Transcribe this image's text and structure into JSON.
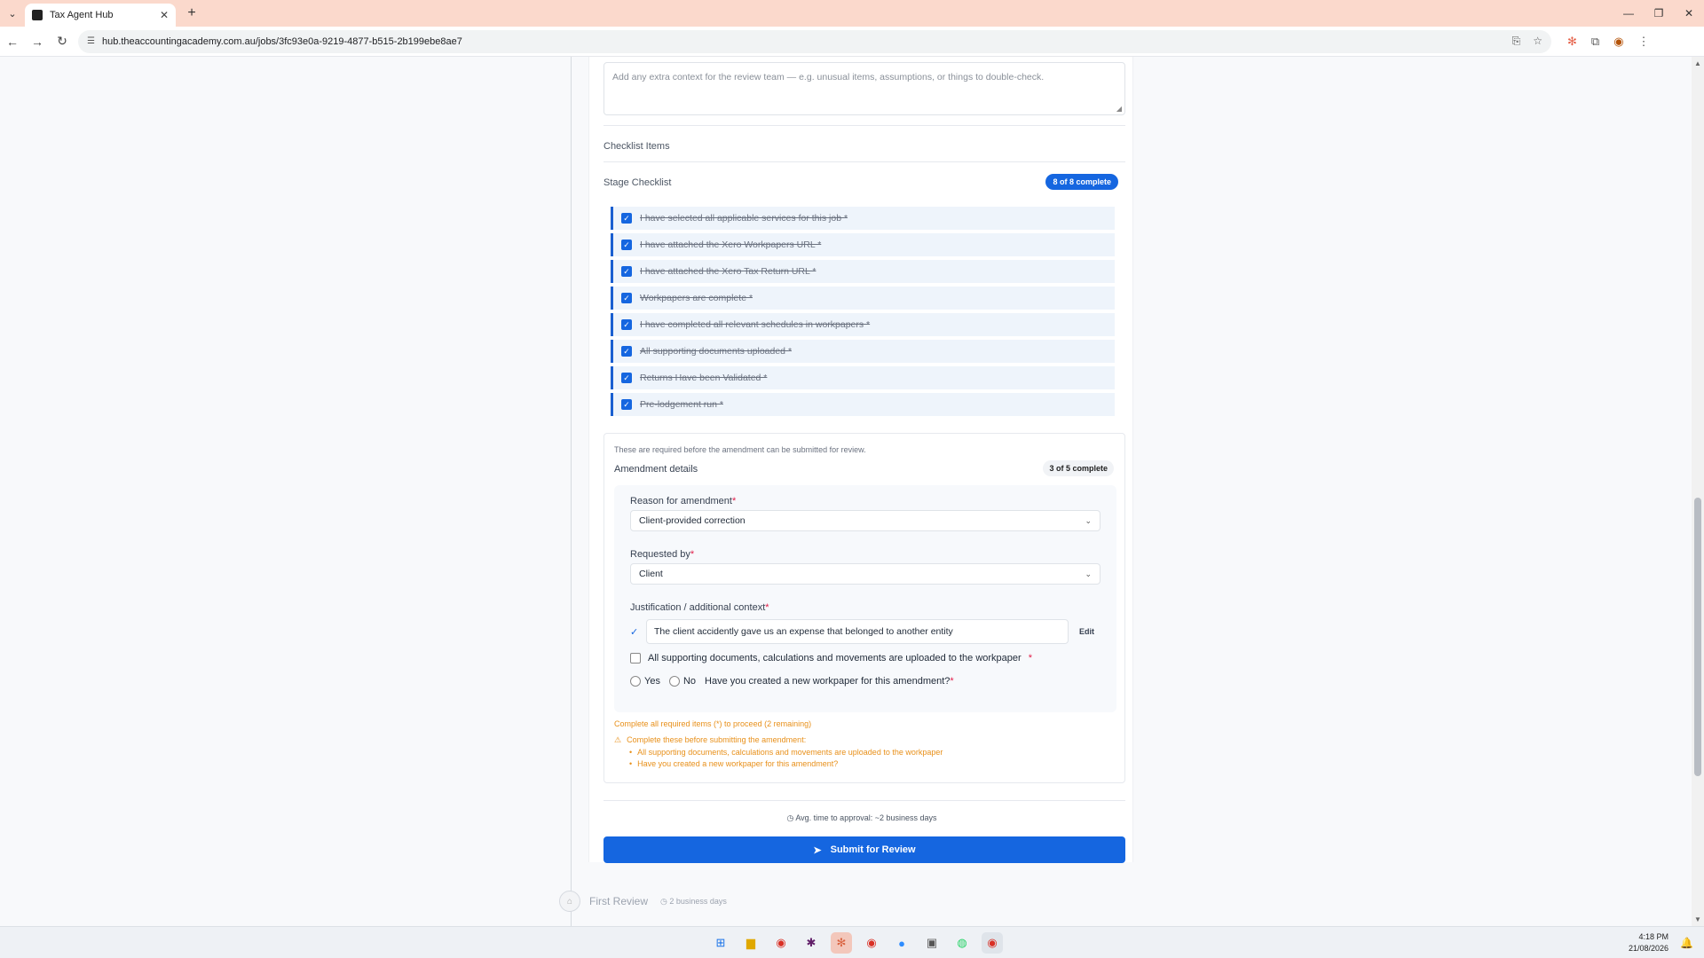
{
  "browser": {
    "tab_title": "Tax Agent Hub",
    "url": "hub.theaccountingacademy.com.au/jobs/3fc93e0a-9219-4877-b515-2b199ebe8ae7"
  },
  "notes": {
    "placeholder": "Add any extra context for the review team — e.g. unusual items, assumptions, or things to double-check."
  },
  "checklist": {
    "section_title": "Checklist Items",
    "stage_title": "Stage Checklist",
    "badge": "8 of 8 complete",
    "items": [
      {
        "label": "I have selected all applicable services for this job *",
        "checked": true
      },
      {
        "label": "I have attached the Xero Workpapers URL *",
        "checked": true
      },
      {
        "label": "I have attached the Xero Tax Return URL *",
        "checked": true
      },
      {
        "label": "Workpapers are complete *",
        "checked": true
      },
      {
        "label": "I have completed all relevant schedules in workpapers *",
        "checked": true
      },
      {
        "label": "All supporting documents uploaded *",
        "checked": true
      },
      {
        "label": "Returns Have been Validated *",
        "checked": true
      },
      {
        "label": "Pre-lodgement run *",
        "checked": true
      }
    ]
  },
  "amendment": {
    "note": "These are required before the amendment can be submitted for review.",
    "title": "Amendment details",
    "badge": "3 of 5 complete",
    "reason_label": "Reason for amendment",
    "reason_value": "Client-provided correction",
    "requested_label": "Requested by",
    "requested_value": "Client",
    "justification_label": "Justification / additional context",
    "justification_value": "The client accidently gave us an expense that belonged to another entity",
    "edit_label": "Edit",
    "docs_checkbox_label": "All supporting documents, calculations and movements are uploaded to the workpaper",
    "yes_label": "Yes",
    "no_label": "No",
    "workpaper_question": "Have you created a new workpaper for this amendment?",
    "required_mark": "*",
    "warning_summary": "Complete all required items (*) to proceed (2 remaining)",
    "warning_heading": "Complete these before submitting the amendment:",
    "warning_items": [
      "All supporting documents, calculations and movements are uploaded to the workpaper",
      "Have you created a new workpaper for this amendment?"
    ]
  },
  "approval": {
    "avg_time": "Avg. time to approval: ~2 business days",
    "submit_label": "Submit for Review"
  },
  "next_stage": {
    "label": "First Review",
    "duration": "2 business days"
  },
  "taskbar": {
    "time": "4:18 PM",
    "date": "21/08/2026"
  }
}
